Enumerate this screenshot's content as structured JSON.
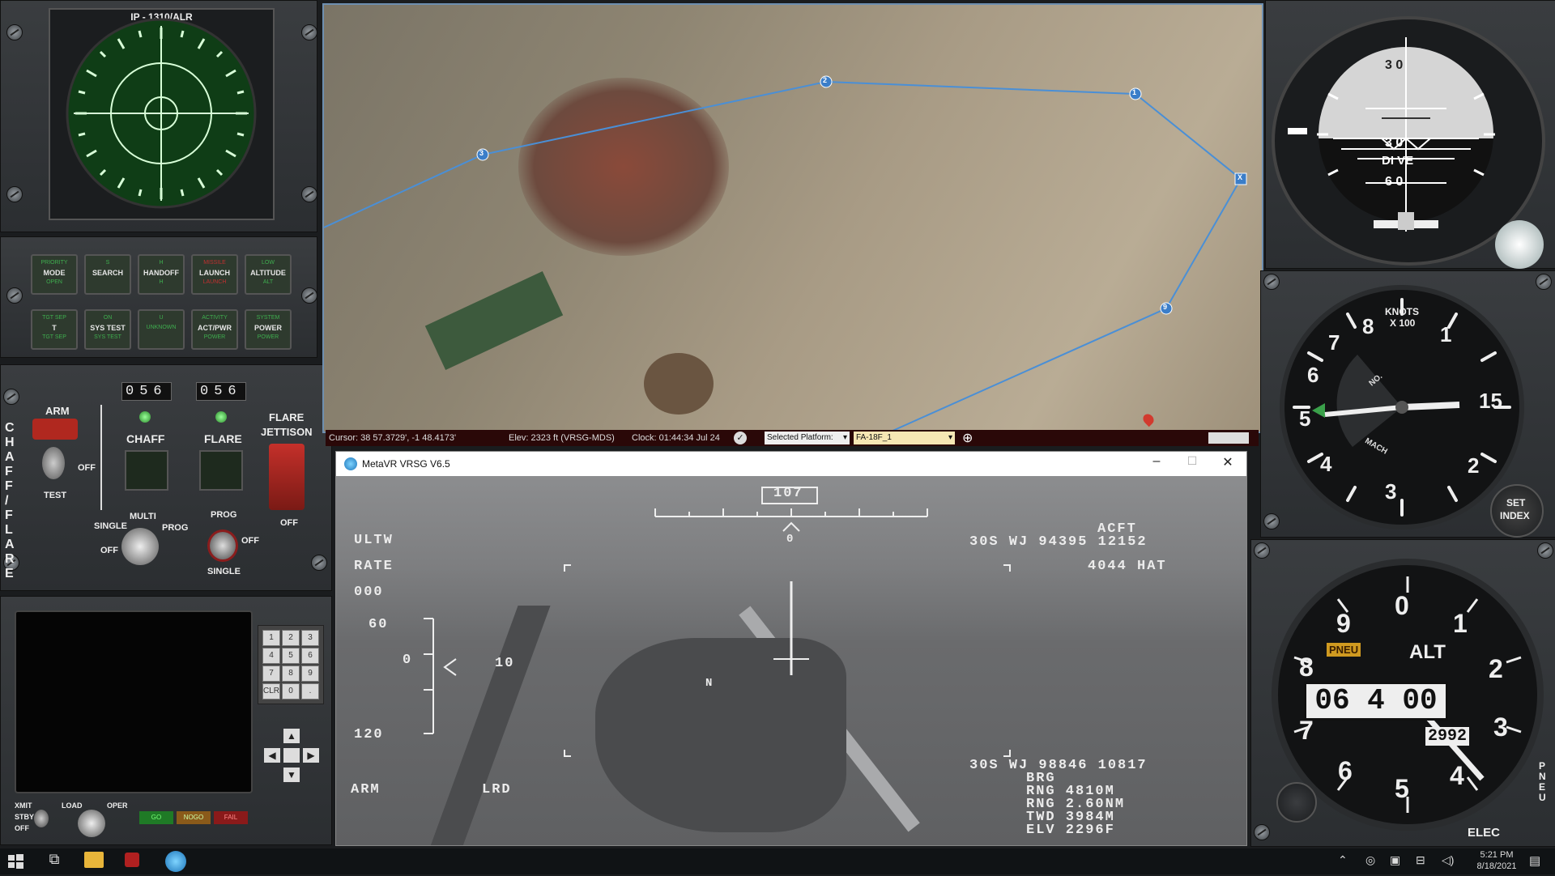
{
  "rwr": {
    "title": "IP - 1310/ALR"
  },
  "mode_buttons": [
    {
      "top": "PRIORITY",
      "mid": "MODE",
      "bot": "OPEN",
      "topRed": false,
      "botRed": false
    },
    {
      "top": "S",
      "mid": "SEARCH",
      "bot": "",
      "topRed": false,
      "botRed": false
    },
    {
      "top": "H",
      "mid": "HANDOFF",
      "bot": "H",
      "topRed": false,
      "botRed": false
    },
    {
      "top": "MISSILE",
      "mid": "LAUNCH",
      "bot": "LAUNCH",
      "topRed": true,
      "botRed": true
    },
    {
      "top": "LOW",
      "mid": "ALTITUDE",
      "bot": "ALT",
      "topRed": false,
      "botRed": false
    },
    {
      "top": "TGT SEP",
      "mid": "T",
      "bot": "TGT SEP",
      "topRed": false,
      "botRed": false
    },
    {
      "top": "ON",
      "mid": "SYS TEST",
      "bot": "SYS TEST",
      "topRed": false,
      "botRed": false
    },
    {
      "top": "U",
      "mid": "",
      "bot": "UNKNOWN",
      "topRed": false,
      "botRed": false
    },
    {
      "top": "ACTIVITY",
      "mid": "ACT/PWR",
      "bot": "POWER",
      "topRed": false,
      "botRed": false
    },
    {
      "top": "SYSTEM",
      "mid": "POWER",
      "bot": "POWER",
      "topRed": false,
      "botRed": false
    }
  ],
  "cmds": {
    "chaff_counter": "056",
    "flare_counter": "056",
    "arm_label": "ARM",
    "off_label": "OFF",
    "test_label": "TEST",
    "chaff_label": "CHAFF",
    "flare_label": "FLARE",
    "jettison_label1": "FLARE",
    "jettison_label2": "JETTISON",
    "jettison_off": "OFF",
    "side_label": "C H A F F / F L A R E",
    "multi_label": "MULTI",
    "single_label": "SINGLE",
    "prog_label": "PROG",
    "off2_label": "OFF",
    "prog2_label": "PROG",
    "off3_label": "OFF",
    "single2_label": "SINGLE"
  },
  "keypad": {
    "keys": [
      "1",
      "2",
      "3",
      "4",
      "5",
      "6",
      "7",
      "8",
      "9",
      "CLR",
      "0",
      "."
    ]
  },
  "bottom_left": {
    "xmit": "XMIT",
    "stby": "STBY",
    "off": "OFF",
    "load": "LOAD",
    "oper": "OPER",
    "go": "GO",
    "nogo": "NOGO",
    "fail": "FAIL"
  },
  "map": {
    "cursor": "Cursor: 38 57.3729', -1 48.4173'",
    "elev": "Elev: 2323 ft (VRSG-MDS)",
    "clock": "Clock: 01:44:34   Jul 24",
    "selected_platform_label": "Selected Platform:",
    "platform_value": "FA-18F_1",
    "waypoints": [
      "1",
      "2",
      "3",
      "9",
      "X"
    ]
  },
  "window": {
    "title": "MetaVR VRSG V6.5"
  },
  "hud": {
    "heading": "107",
    "scale_zero": "0",
    "ultw": "ULTW",
    "rate": "RATE",
    "rate_val": "000",
    "p60": "60",
    "p0": "0",
    "p120": "120",
    "speed": "10",
    "north": "N",
    "acft": "ACFT",
    "line1": "30S WJ 94395 12152",
    "hat": "4044 HAT",
    "line2": "30S WJ 98846 10817",
    "brg": "BRG",
    "rng1": "RNG   4810M",
    "rng2": "RNG   2.60NM",
    "twd": "TWD   3984M",
    "elv": "ELV   2296F",
    "arm": "ARM",
    "lrd": "LRD"
  },
  "adi": {
    "top": "3 0",
    "mid": "3 0",
    "dive": "DI VE",
    "bot": "6 0"
  },
  "airspeed": {
    "label1": "KNOTS",
    "label2": "X 100",
    "mach": "MACH",
    "no": "NO.",
    "set": "SET",
    "index": "INDEX",
    "nums": [
      "8",
      "1",
      "15",
      "2",
      "3",
      "4",
      "5",
      "6",
      "7"
    ]
  },
  "altimeter": {
    "label": "ALT",
    "pneu": "PNEU",
    "reading": "06 4 00",
    "baro": "2992",
    "elec": "ELEC",
    "pneu_side": "P N E U",
    "nums": [
      "0",
      "1",
      "2",
      "3",
      "4",
      "5",
      "6",
      "7",
      "8",
      "9"
    ]
  },
  "taskbar": {
    "time": "5:21 PM",
    "date": "8/18/2021"
  },
  "colors": {
    "rwr_green": "#0f3d16",
    "hud_bg": "#6b6c6e",
    "taskbar": "#101315",
    "status_bar": "#2a0808"
  }
}
